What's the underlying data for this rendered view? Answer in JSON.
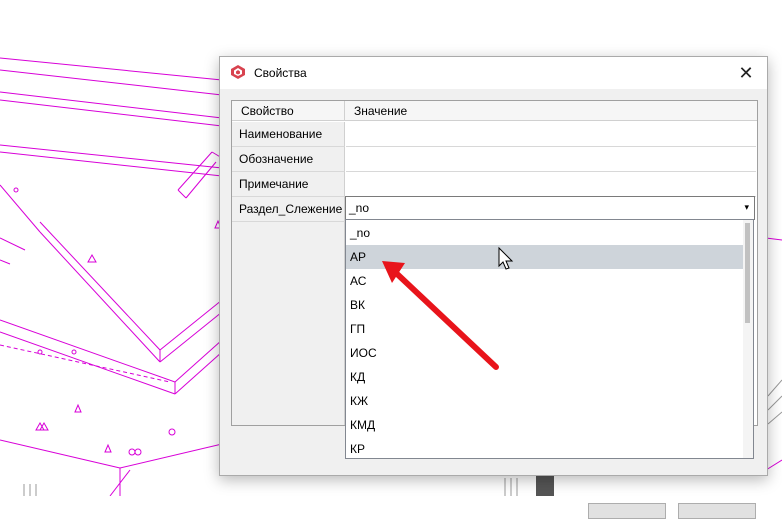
{
  "dialog": {
    "title": "Свойства",
    "close_glyph": "✕",
    "icon": "app-logo-icon"
  },
  "grid": {
    "columns": [
      "Свойство",
      "Значение"
    ],
    "rows": [
      {
        "key": "Наименование",
        "value": ""
      },
      {
        "key": "Обозначение",
        "value": ""
      },
      {
        "key": "Примечание",
        "value": ""
      },
      {
        "key": "Раздел_Слежение",
        "value": "_no"
      }
    ]
  },
  "combo": {
    "value": "_no",
    "arrow_glyph": "▾"
  },
  "dropdown": {
    "options": [
      "_no",
      "АР",
      "АС",
      "ВК",
      "ГП",
      "ИОС",
      "КД",
      "КЖ",
      "КМД",
      "КР"
    ],
    "highlighted": "АР"
  },
  "colors": {
    "cad_lines": "#d800d8",
    "highlight": "#ced4da",
    "annotation_arrow": "#e8141b"
  }
}
